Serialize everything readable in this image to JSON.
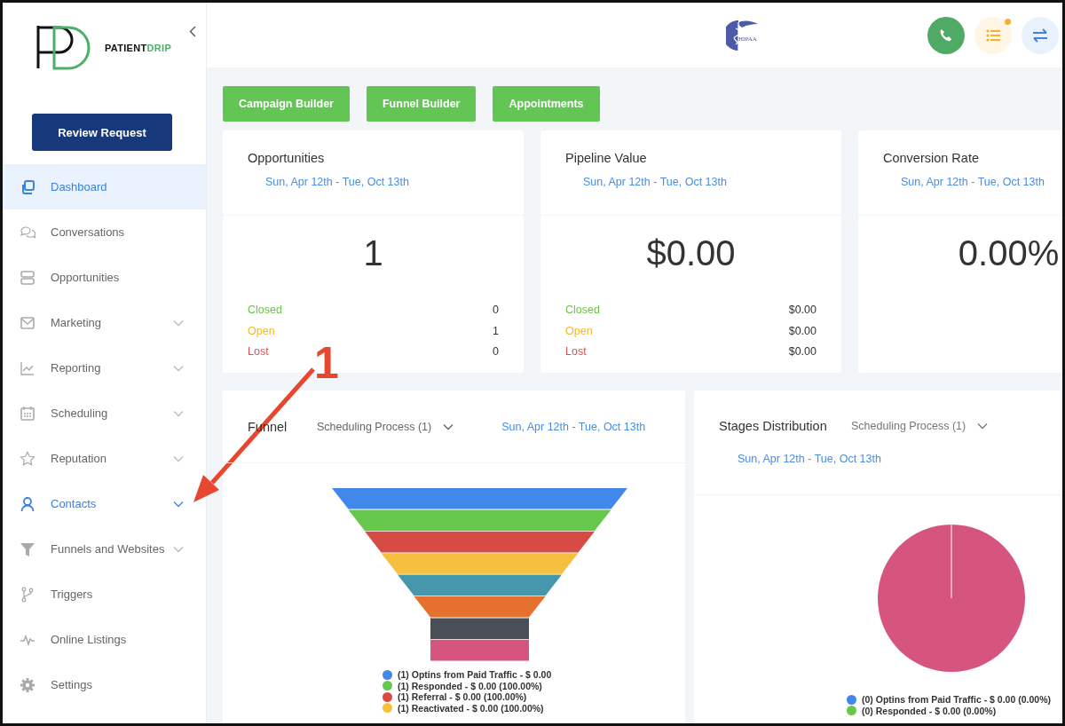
{
  "sidebar": {
    "logo": {
      "word_dark": "PATIENT",
      "word_accent": "DRIP"
    },
    "primary_button": "Review Request",
    "items": [
      {
        "label": "Dashboard",
        "selected": true,
        "highlighted": false,
        "has_submenu": false
      },
      {
        "label": "Conversations",
        "selected": false,
        "highlighted": false,
        "has_submenu": false
      },
      {
        "label": "Opportunities",
        "selected": false,
        "highlighted": false,
        "has_submenu": false
      },
      {
        "label": "Marketing",
        "selected": false,
        "highlighted": false,
        "has_submenu": true
      },
      {
        "label": "Reporting",
        "selected": false,
        "highlighted": false,
        "has_submenu": true
      },
      {
        "label": "Scheduling",
        "selected": false,
        "highlighted": false,
        "has_submenu": true
      },
      {
        "label": "Reputation",
        "selected": false,
        "highlighted": false,
        "has_submenu": true
      },
      {
        "label": "Contacts",
        "selected": false,
        "highlighted": true,
        "has_submenu": true
      },
      {
        "label": "Funnels and Websites",
        "selected": false,
        "highlighted": false,
        "has_submenu": true
      },
      {
        "label": "Triggers",
        "selected": false,
        "highlighted": false,
        "has_submenu": false
      },
      {
        "label": "Online Listings",
        "selected": false,
        "highlighted": false,
        "has_submenu": false
      },
      {
        "label": "Settings",
        "selected": false,
        "highlighted": false,
        "has_submenu": false
      }
    ]
  },
  "header": {
    "hipaa_logo_text": "HIPAA",
    "notification_dot": true
  },
  "action_buttons": [
    "Campaign Builder",
    "Funnel Builder",
    "Appointments"
  ],
  "stat_cards": [
    {
      "title": "Opportunities",
      "date_range": "Sun, Apr 12th - Tue, Oct 13th",
      "value": "1",
      "rows": [
        {
          "label": "Closed",
          "value": "0",
          "kind": "closed"
        },
        {
          "label": "Open",
          "value": "1",
          "kind": "open"
        },
        {
          "label": "Lost",
          "value": "0",
          "kind": "lost"
        }
      ]
    },
    {
      "title": "Pipeline Value",
      "date_range": "Sun, Apr 12th - Tue, Oct 13th",
      "value": "$0.00",
      "rows": [
        {
          "label": "Closed",
          "value": "$0.00",
          "kind": "closed"
        },
        {
          "label": "Open",
          "value": "$0.00",
          "kind": "open"
        },
        {
          "label": "Lost",
          "value": "$0.00",
          "kind": "lost"
        }
      ]
    },
    {
      "title": "Conversion Rate",
      "date_range": "Sun, Apr 12th - Tue, Oct 13th",
      "value": "0.00%"
    }
  ],
  "funnel_card": {
    "title": "Funnel",
    "pipeline": "Scheduling Process (1)",
    "date_range": "Sun, Apr 12th - Tue, Oct 13th",
    "bands": [
      {
        "color": "#4287ea"
      },
      {
        "color": "#66c74d"
      },
      {
        "color": "#d64c45"
      },
      {
        "color": "#f5c040"
      },
      {
        "color": "#4697ab"
      },
      {
        "color": "#e6702e"
      },
      {
        "color": "#4a4f57"
      },
      {
        "color": "#d6557f"
      }
    ],
    "legend": [
      {
        "text": "(1) Optins from Paid Traffic - $ 0.00",
        "color": "#4287ea"
      },
      {
        "text": "(1) Responded - $ 0.00 (100.00%)",
        "color": "#66c74d"
      },
      {
        "text": "(1) Referral - $ 0.00 (100.00%)",
        "color": "#d64c45"
      },
      {
        "text": "(1) Reactivated - $ 0.00 (100.00%)",
        "color": "#f5c040"
      }
    ]
  },
  "stages_card": {
    "title": "Stages Distribution",
    "pipeline": "Scheduling Process (1)",
    "date_range": "Sun, Apr 12th - Tue, Oct 13th",
    "legend": [
      {
        "text": "(0) Optins from Paid Traffic - $ 0.00 (0.00%)",
        "color": "#4287ea"
      },
      {
        "text": "(0) Responded - $ 0.00 (0.00%)",
        "color": "#66c74d"
      }
    ]
  },
  "annotation": {
    "label": "1"
  }
}
